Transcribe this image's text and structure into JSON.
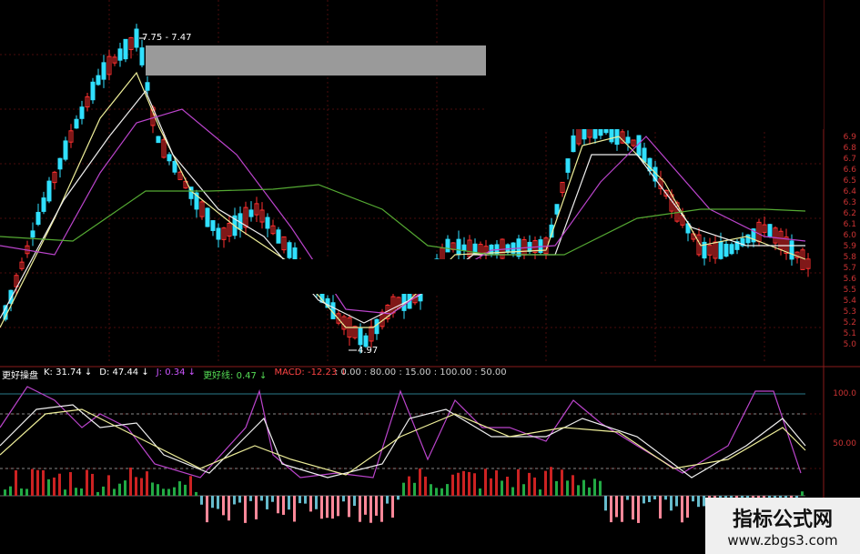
{
  "price_panel": {
    "high_label": "7.75 - 7.47",
    "low_label": "4.97",
    "axis_ticks": [
      "6.9",
      "6.8",
      "6.7",
      "6.6",
      "6.5",
      "6.4",
      "6.3",
      "6.2",
      "6.1",
      "6.0",
      "5.9",
      "5.8",
      "5.7",
      "5.6",
      "5.5",
      "5.4",
      "5.3",
      "5.2",
      "5.1",
      "5.0"
    ]
  },
  "indicator_panel": {
    "name": "更好操盘",
    "items": [
      {
        "label": "K: 31.74",
        "arrow": "↓",
        "color": "#ffffff"
      },
      {
        "label": "D: 47.44",
        "arrow": "↓",
        "color": "#ffffff"
      },
      {
        "label": "J: 0.34",
        "arrow": "↓",
        "color": "#cc55ff"
      },
      {
        "label": "更好线: 0.47",
        "arrow": "↓",
        "color": "#55dd55"
      },
      {
        "label": "MACD: -12.23",
        "arrow": "↓",
        "color": "#ff4444"
      }
    ],
    "params": ": 0.00  : 80.00  : 15.00  : 100.00  : 50.00",
    "axis_ticks": [
      "100.0",
      "50.00"
    ]
  },
  "watermark": {
    "title": "指标公式网",
    "url": "www.zbgs3.com"
  },
  "colors": {
    "up": "#ff3030",
    "down": "#30e0ff",
    "ma_white": "#eeeeee",
    "ma_yellow": "#eeee99",
    "ma_purple": "#bb44cc",
    "ma_green": "#55aa33",
    "grid": "#551111"
  }
}
